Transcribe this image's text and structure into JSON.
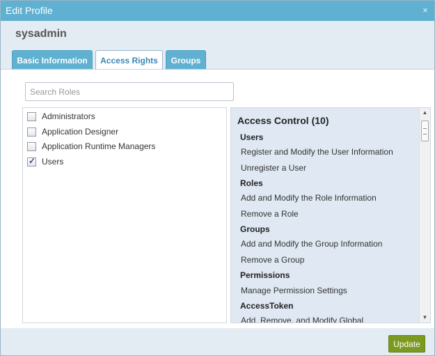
{
  "window": {
    "title": "Edit Profile",
    "close_glyph": "×"
  },
  "profile": {
    "username": "sysadmin"
  },
  "tabs": [
    {
      "label": "Basic Information",
      "active": false
    },
    {
      "label": "Access Rights",
      "active": true
    },
    {
      "label": "Groups",
      "active": false
    }
  ],
  "search": {
    "placeholder": "Search Roles",
    "value": ""
  },
  "roles": [
    {
      "label": "Administrators",
      "checked": false
    },
    {
      "label": "Application Designer",
      "checked": false
    },
    {
      "label": "Application Runtime Managers",
      "checked": false
    },
    {
      "label": "Users",
      "checked": true
    }
  ],
  "access_control": {
    "title": "Access Control  (10)",
    "groups": [
      {
        "name": "Users",
        "permissions": [
          "Register and Modify the User Information",
          "Unregister a User"
        ]
      },
      {
        "name": "Roles",
        "permissions": [
          "Add and Modify the Role Information",
          "Remove a Role"
        ]
      },
      {
        "name": "Groups",
        "permissions": [
          "Add and Modify the Group Information",
          "Remove a Group"
        ]
      },
      {
        "name": "Permissions",
        "permissions": [
          "Manage Permission Settings"
        ]
      },
      {
        "name": "AccessToken",
        "permissions": [
          "Add, Remove, and Modify Global"
        ]
      }
    ]
  },
  "scrollbar": {
    "up_glyph": "▲",
    "down_glyph": "▼"
  },
  "footer": {
    "update_label": "Update"
  },
  "colors": {
    "titlebar": "#5fb0d1",
    "update_button": "#7c9a1f",
    "rights_bg": "#dfe8f3"
  }
}
